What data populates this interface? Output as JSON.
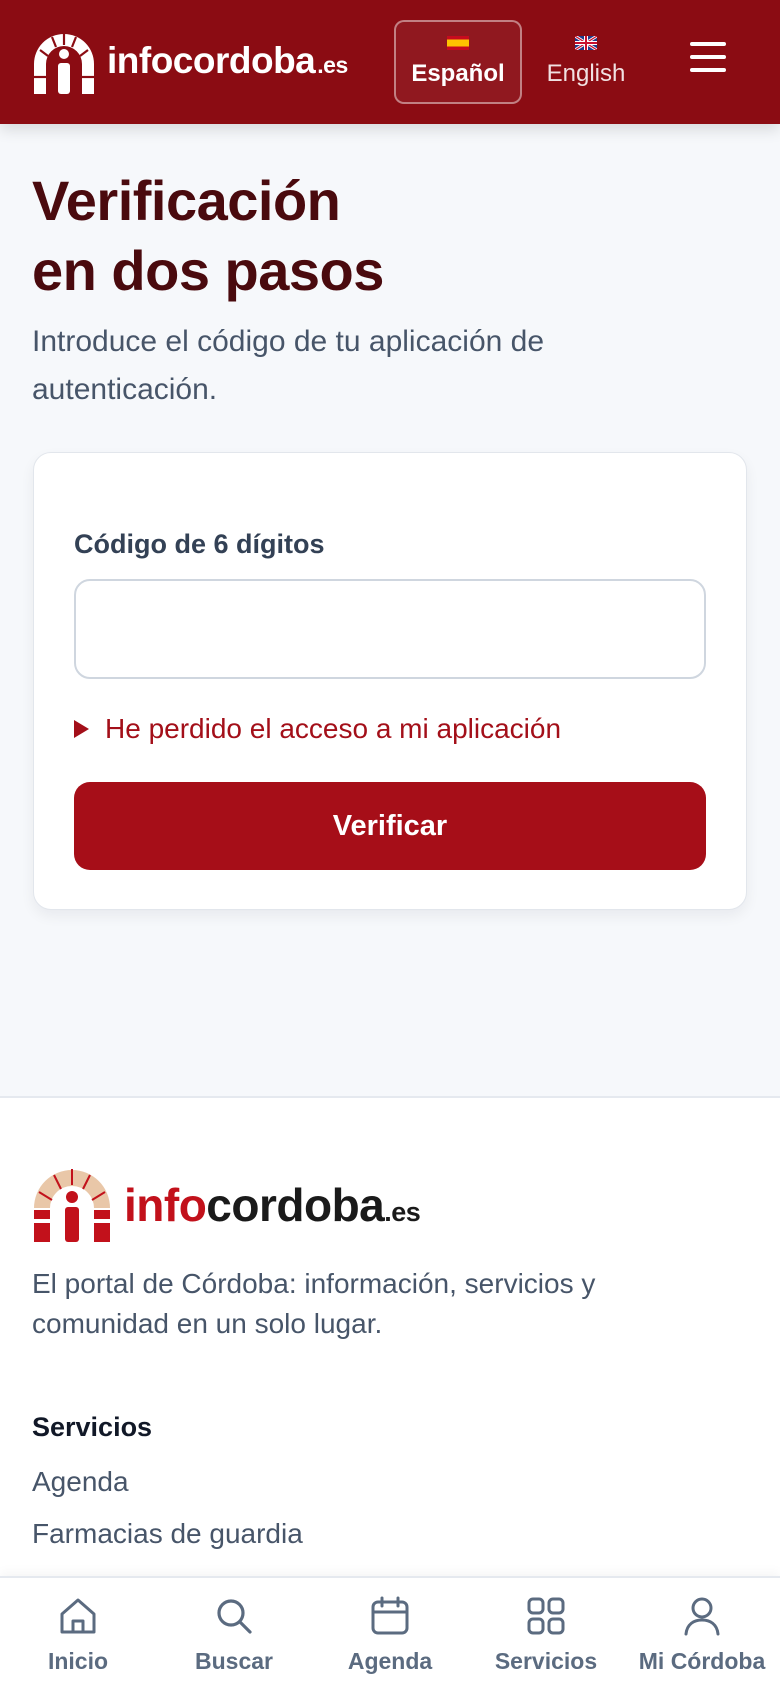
{
  "header": {
    "logo_name": "infocordoba",
    "logo_tld": ".es",
    "languages": [
      {
        "label": "Español",
        "active": true
      },
      {
        "label": "English",
        "active": false
      }
    ],
    "menu_icon": "hamburger-icon"
  },
  "main": {
    "title_line1": "Verificación",
    "title_line2": "en dos pasos",
    "subtitle": "Introduce el código de tu aplicación de autenticación.",
    "code_label": "Código de 6 dígitos",
    "code_value": "",
    "lost_access": "He perdido el acceso a mi aplicación",
    "verify_label": "Verificar"
  },
  "footer": {
    "logo_info": "info",
    "logo_rest": "cordoba",
    "logo_tld": ".es",
    "description": "El portal de Córdoba: información, servicios y comunidad en un solo lugar.",
    "section_heading": "Servicios",
    "links": [
      "Agenda",
      "Farmacias de guardia"
    ]
  },
  "bottom_nav": [
    {
      "label": "Inicio",
      "icon": "home-icon"
    },
    {
      "label": "Buscar",
      "icon": "search-icon"
    },
    {
      "label": "Agenda",
      "icon": "calendar-icon"
    },
    {
      "label": "Servicios",
      "icon": "grid-icon"
    },
    {
      "label": "Mi Córdoba",
      "icon": "user-icon"
    }
  ],
  "colors": {
    "brand": "#8b0c13",
    "primary_button": "#a60e18",
    "title": "#4a0a0e",
    "link": "#a30f19"
  }
}
